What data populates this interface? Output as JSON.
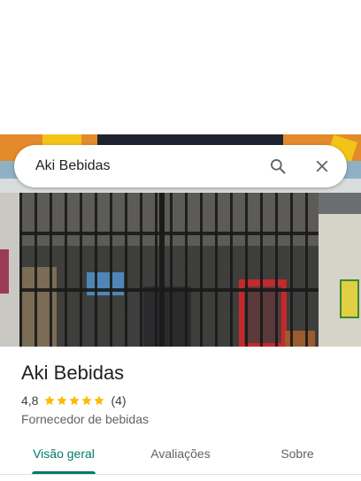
{
  "search": {
    "query": "Aki Bebidas"
  },
  "place": {
    "name": "Aki Bebidas",
    "rating": "4,8",
    "stars": 5,
    "review_count": "(4)",
    "category": "Fornecedor de bebidas"
  },
  "tabs": [
    {
      "label": "Visão geral",
      "selected": true
    },
    {
      "label": "Avaliações",
      "selected": false
    },
    {
      "label": "Sobre",
      "selected": false
    }
  ],
  "icons": {
    "search": "search-icon",
    "close": "close-icon",
    "star": "star-icon"
  },
  "colors": {
    "accent": "#00796b",
    "star": "#fbbc04",
    "text_primary": "#202124",
    "text_secondary": "#5f6368"
  }
}
